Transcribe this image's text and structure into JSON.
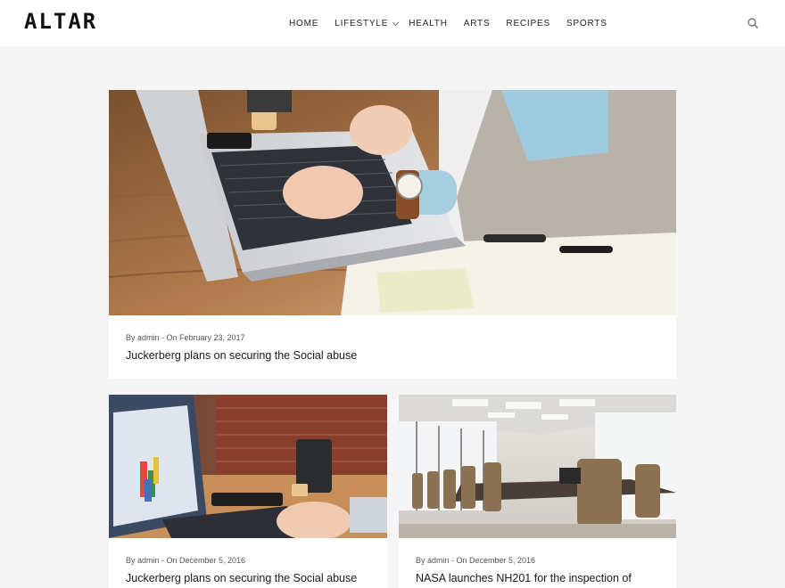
{
  "header": {
    "logo": "ALTAR",
    "nav": [
      {
        "label": "HOME"
      },
      {
        "label": "LIFESTYLE"
      },
      {
        "label": "HEALTH"
      },
      {
        "label": "ARTS"
      },
      {
        "label": "RECIPES"
      },
      {
        "label": "SPORTS"
      }
    ],
    "search_icon": "search-icon"
  },
  "posts": [
    {
      "meta": "By admin - On February 23, 2017",
      "title": "Juckerberg plans on securing the Social abuse"
    },
    {
      "meta": "By admin - On December 5, 2016",
      "title": "Juckerberg plans on securing the Social abuse"
    },
    {
      "meta": "By admin - On December 5, 2016",
      "title": "NASA launches NH201 for the inspection of"
    }
  ],
  "colors": {
    "page_bg": "#f5f5f5",
    "card_bg": "#ffffff",
    "text": "#1a1a1a",
    "meta": "#555555"
  }
}
